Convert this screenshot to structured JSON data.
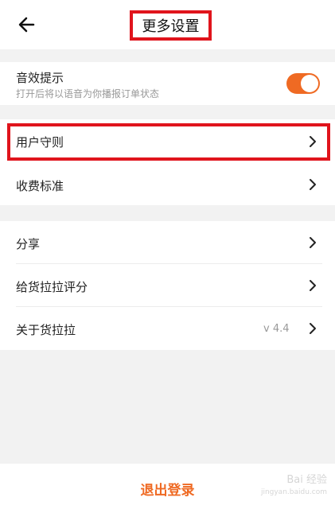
{
  "header": {
    "title": "更多设置",
    "back_icon": "arrow-left-icon"
  },
  "sound": {
    "label": "音效提示",
    "sub": "打开后将以语音为你播报订单状态",
    "toggle_on": true,
    "accent": "#ef6a23"
  },
  "rules": {
    "label": "用户守则"
  },
  "fees": {
    "label": "收费标准"
  },
  "share": {
    "label": "分享"
  },
  "rate": {
    "label": "给货拉拉评分"
  },
  "about": {
    "label": "关于货拉拉",
    "version": "v 4.4"
  },
  "footer": {
    "logout_label": "退出登录"
  },
  "watermark": {
    "text": "Bai 经验",
    "sub": "jingyan.baidu.com"
  },
  "colors": {
    "highlight": "#e0141c",
    "background": "#f2f2f2"
  }
}
